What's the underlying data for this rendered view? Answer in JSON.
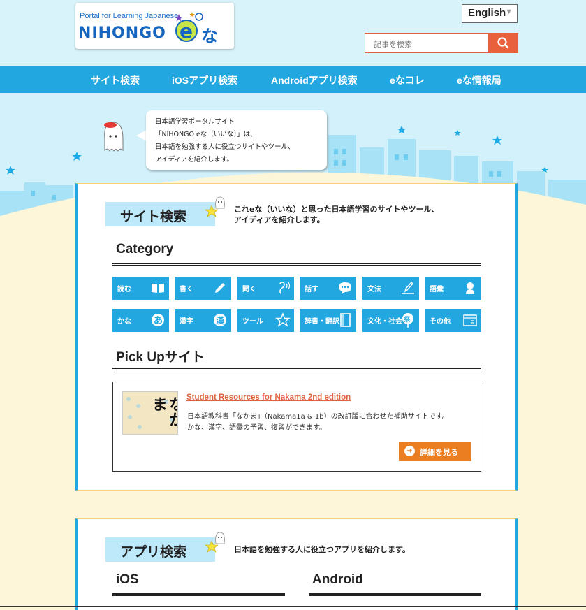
{
  "header": {
    "logo_subtitle": "Portal for Learning Japanese",
    "logo_main": "NIHONGO",
    "logo_na": "な",
    "language": "English",
    "search_placeholder": "記事を検索"
  },
  "nav": {
    "items": [
      "サイト検索",
      "iOSアプリ検索",
      "Androidアプリ検索",
      "eなコレ",
      "eな情報局"
    ]
  },
  "hero": {
    "speech_lines": [
      "日本語学習ポータルサイト",
      "「NIHONGO eな（いいな）」は、",
      "日本語を勉強する人に役立つサイトやツール、",
      "アイディアを紹介します。"
    ]
  },
  "site_search": {
    "title": "サイト検索",
    "description_lines": [
      "これeな（いいな）と思った日本語学習のサイトやツール、",
      "アイディアを紹介します。"
    ],
    "category_heading": "Category",
    "categories": [
      {
        "label": "読む",
        "icon": "book-icon"
      },
      {
        "label": "書く",
        "icon": "pencil-icon"
      },
      {
        "label": "聞く",
        "icon": "ear-icon"
      },
      {
        "label": "話す",
        "icon": "speech-bubble-icon"
      },
      {
        "label": "文法",
        "icon": "writing-icon"
      },
      {
        "label": "語彙",
        "icon": "person-icon"
      },
      {
        "label": "かな",
        "icon": "hiragana-a-icon"
      },
      {
        "label": "漢字",
        "icon": "kanji-icon"
      },
      {
        "label": "ツール",
        "icon": "star-icon"
      },
      {
        "label": "辞書・翻訳",
        "icon": "dictionary-icon"
      },
      {
        "label": "文化・社会",
        "icon": "fan-icon"
      },
      {
        "label": "その他",
        "icon": "window-icon"
      }
    ],
    "pickup_heading": "Pick Upサイト",
    "pickup": {
      "thumb_text": "なかま",
      "title": "Student Resources for Nakama 2nd edition",
      "desc_lines": [
        "日本語教科書「なかま」（Nakama1a & 1b）の改訂版に合わせた補助サイトです。",
        "かな、漢字、語彙の予習、復習ができます。"
      ],
      "detail_label": "詳細を見る"
    }
  },
  "app_search": {
    "title": "アプリ検索",
    "description": "日本語を勉強する人に役立つアプリを紹介します。",
    "ios_heading": "iOS",
    "android_heading": "Android"
  },
  "colors": {
    "header_bg": "#d9f3fb",
    "nav_bg": "#22a7e0",
    "accent_orange": "#e9603c",
    "button_orange": "#ec7e22",
    "sky_bg": "#d2f1fb",
    "cream_bg": "#fdf6d8"
  }
}
